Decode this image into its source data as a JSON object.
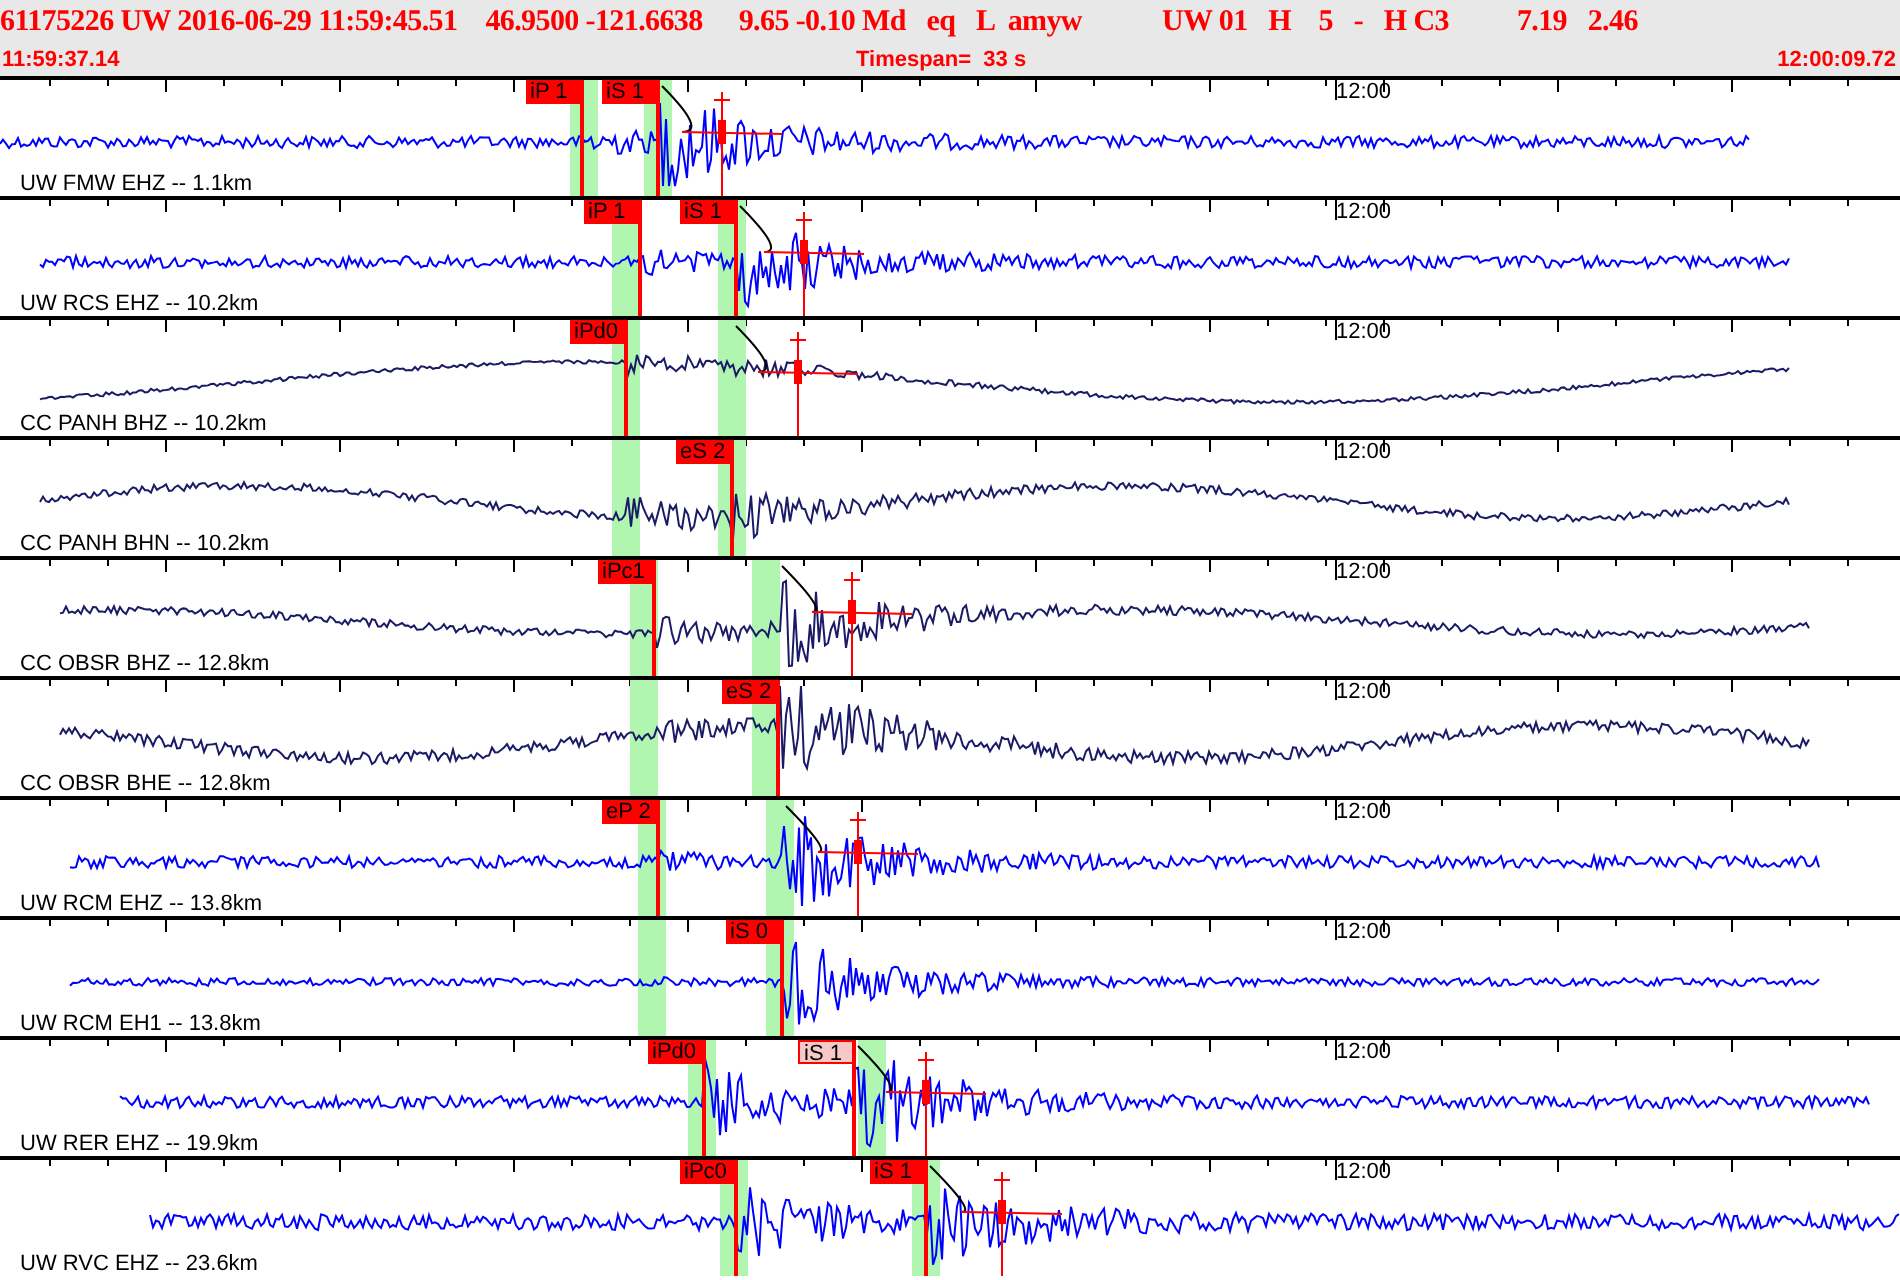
{
  "header": {
    "segments": [
      "61175226 UW 2016-06-29 11:59:45.51",
      "46.9500 -121.6638",
      "9.65 -0.10 Md   eq   L  amyw",
      "UW 01   H    5   -   H C3",
      "7.19   2.46"
    ],
    "start_time": "11:59:37.14",
    "timespan": "Timespan=  33 s",
    "end_time": "12:00:09.72"
  },
  "traces": [
    {
      "station": "UW FMW EHZ -- 1.1km",
      "time_mark": "12:00",
      "color": "#0000ff",
      "picks": [
        {
          "label": "iP 1",
          "dimmed": false
        },
        {
          "label": "iS 1",
          "dimmed": false
        }
      ]
    },
    {
      "station": "UW RCS EHZ -- 10.2km",
      "time_mark": "12:00",
      "color": "#0000ff",
      "picks": [
        {
          "label": "iP 1",
          "dimmed": false
        },
        {
          "label": "iS 1",
          "dimmed": false
        }
      ]
    },
    {
      "station": "CC PANH BHZ -- 10.2km",
      "time_mark": "12:00",
      "color": "#1a1a66",
      "picks": [
        {
          "label": "iPd0",
          "dimmed": false
        }
      ]
    },
    {
      "station": "CC PANH BHN -- 10.2km",
      "time_mark": "12:00",
      "color": "#1a1a66",
      "picks": [
        {
          "label": "eS 2",
          "dimmed": false
        }
      ]
    },
    {
      "station": "CC OBSR BHZ -- 12.8km",
      "time_mark": "12:00",
      "color": "#1a1a66",
      "picks": [
        {
          "label": "iPc1",
          "dimmed": false
        }
      ]
    },
    {
      "station": "CC OBSR BHE -- 12.8km",
      "time_mark": "12:00",
      "color": "#1a1a66",
      "picks": [
        {
          "label": "eS 2",
          "dimmed": false
        }
      ]
    },
    {
      "station": "UW RCM EHZ -- 13.8km",
      "time_mark": "12:00",
      "color": "#0000ff",
      "picks": [
        {
          "label": "eP 2",
          "dimmed": false
        }
      ]
    },
    {
      "station": "UW RCM EH1 -- 13.8km",
      "time_mark": "12:00",
      "color": "#0000ff",
      "picks": [
        {
          "label": "iS 0",
          "dimmed": false
        }
      ]
    },
    {
      "station": "UW RER EHZ -- 19.9km",
      "time_mark": "12:00",
      "color": "#0000ff",
      "picks": [
        {
          "label": "iPd0",
          "dimmed": false
        },
        {
          "label": "iS 1",
          "dimmed": true
        }
      ]
    },
    {
      "station": "UW RVC EHZ -- 23.6km",
      "time_mark": "12:00",
      "color": "#0000ff",
      "picks": [
        {
          "label": "iPc0",
          "dimmed": false
        },
        {
          "label": "iS 1",
          "dimmed": false
        }
      ]
    }
  ]
}
